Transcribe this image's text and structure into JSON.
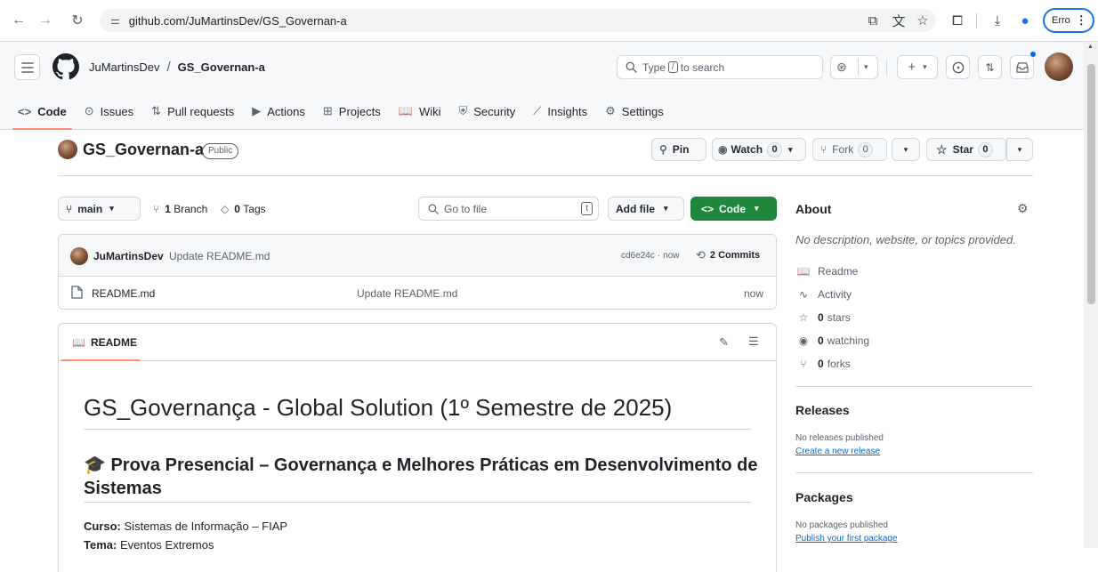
{
  "browser": {
    "url": "github.com/JuMartinsDev/GS_Governan-a",
    "profile_label": "Erro",
    "icons": [
      "back-icon",
      "forward-icon",
      "reload-icon",
      "site-settings-icon",
      "install-app-icon",
      "translate-icon",
      "bookmark-star-icon",
      "extensions-icon",
      "downloads-icon",
      "profile-icon",
      "more-icon"
    ]
  },
  "header": {
    "owner": "JuMartinsDev",
    "slash": "/",
    "repo": "GS_Governan-a",
    "search_prefix": "Type",
    "search_key": "/",
    "search_suffix": "to search",
    "plus": "+"
  },
  "tabs": [
    {
      "icon": "<>",
      "label": "Code"
    },
    {
      "icon": "⊙",
      "label": "Issues"
    },
    {
      "icon": "⇅",
      "label": "Pull requests"
    },
    {
      "icon": "▶",
      "label": "Actions"
    },
    {
      "icon": "⊞",
      "label": "Projects"
    },
    {
      "icon": "📖",
      "label": "Wiki"
    },
    {
      "icon": "⛨",
      "label": "Security"
    },
    {
      "icon": "⟋",
      "label": "Insights"
    },
    {
      "icon": "⚙",
      "label": "Settings"
    }
  ],
  "repo": {
    "title": "GS_Governan-a",
    "visibility": "Public",
    "pin": "Pin",
    "watch": "Watch",
    "watch_count": "0",
    "fork": "Fork",
    "fork_count": "0",
    "star": "Star",
    "star_count": "0"
  },
  "toolbar": {
    "branch": "main",
    "branches_count": "1",
    "branches_label": "Branch",
    "tags_count": "0",
    "tags_label": "Tags",
    "goto_placeholder": "Go to file",
    "goto_key": "t",
    "add_file": "Add file",
    "code": "Code"
  },
  "commit": {
    "author": "JuMartinsDev",
    "message": "Update README.md",
    "hash": "cd6e24c",
    "dot": "·",
    "time": "now",
    "commits_count": "2",
    "commits_label": "Commits"
  },
  "files": [
    {
      "name": "README.md",
      "message": "Update README.md",
      "time": "now"
    }
  ],
  "readme": {
    "tab_label": "README",
    "h1": "GS_Governança - Global Solution (1º Semestre de 2025)",
    "h2_icon": "🎓",
    "h2": "Prova Presencial – Governança e Melhores Práticas em Desenvolvimento de Sistemas",
    "course_label": "Curso:",
    "course_value": "Sistemas de Informação – FIAP",
    "theme_label": "Tema:",
    "theme_value": "Eventos Extremos"
  },
  "about": {
    "heading": "About",
    "description": "No description, website, or topics provided.",
    "items": [
      {
        "icon": "📖",
        "count": "",
        "label": "Readme"
      },
      {
        "icon": "∿",
        "count": "",
        "label": "Activity"
      },
      {
        "icon": "☆",
        "count": "0",
        "label": "stars"
      },
      {
        "icon": "◉",
        "count": "0",
        "label": "watching"
      },
      {
        "icon": "⑂",
        "count": "0",
        "label": "forks"
      }
    ]
  },
  "releases": {
    "heading": "Releases",
    "empty": "No releases published",
    "link": "Create a new release"
  },
  "packages": {
    "heading": "Packages",
    "empty": "No packages published",
    "link": "Publish your first package"
  },
  "colors": {
    "code_button": "#1f883d",
    "link": "#0969da",
    "active_tab_underline": "#fd8c73",
    "profile_ring": "#1a73e8"
  }
}
